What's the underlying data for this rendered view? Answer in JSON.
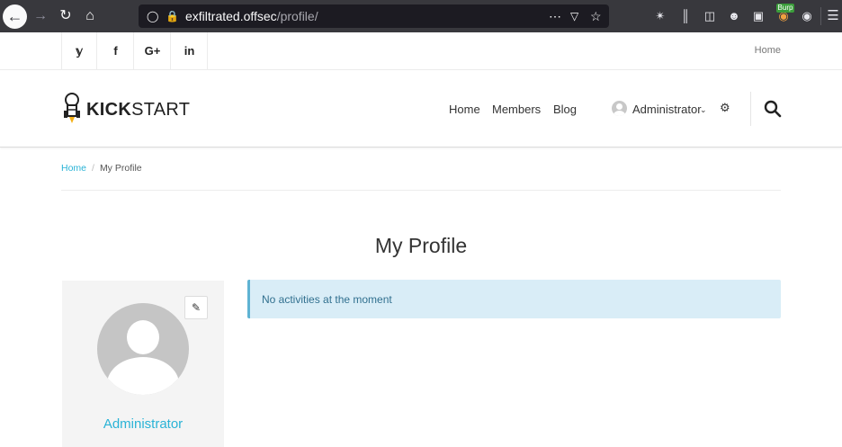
{
  "browser": {
    "url_host": "exfiltrated.offsec",
    "url_path": "/profile/",
    "burp_label": "Burp",
    "icons": [
      "back-icon",
      "forward-icon",
      "reload-icon",
      "home-icon",
      "shield-icon",
      "insecure-lock-icon",
      "more-icon",
      "pocket-icon",
      "bookmark-star-icon",
      "extension-icon",
      "library-icon",
      "sidebar-icon",
      "account-icon",
      "container-icon",
      "burp-icon",
      "cookie-icon",
      "menu-icon"
    ]
  },
  "topbar": {
    "social": [
      "twitter-icon",
      "facebook-icon",
      "google-plus-icon",
      "linkedin-icon"
    ],
    "social_glyphs": [
      "𝕪",
      "f",
      "G+",
      "in"
    ],
    "home_label": "Home"
  },
  "header": {
    "logo_bold": "KICK",
    "logo_rest": "START",
    "nav": {
      "home": "Home",
      "members": "Members",
      "blog": "Blog"
    },
    "user_label": "Administrator"
  },
  "breadcrumb": {
    "home": "Home",
    "current": "My Profile"
  },
  "page": {
    "title": "My Profile",
    "profile_name": "Administrator",
    "alert_text": "No activities at the moment"
  },
  "colors": {
    "accent": "#2ab3d6",
    "alert_bg": "#d9edf7",
    "alert_text": "#31708f",
    "chrome": "#38383d"
  }
}
